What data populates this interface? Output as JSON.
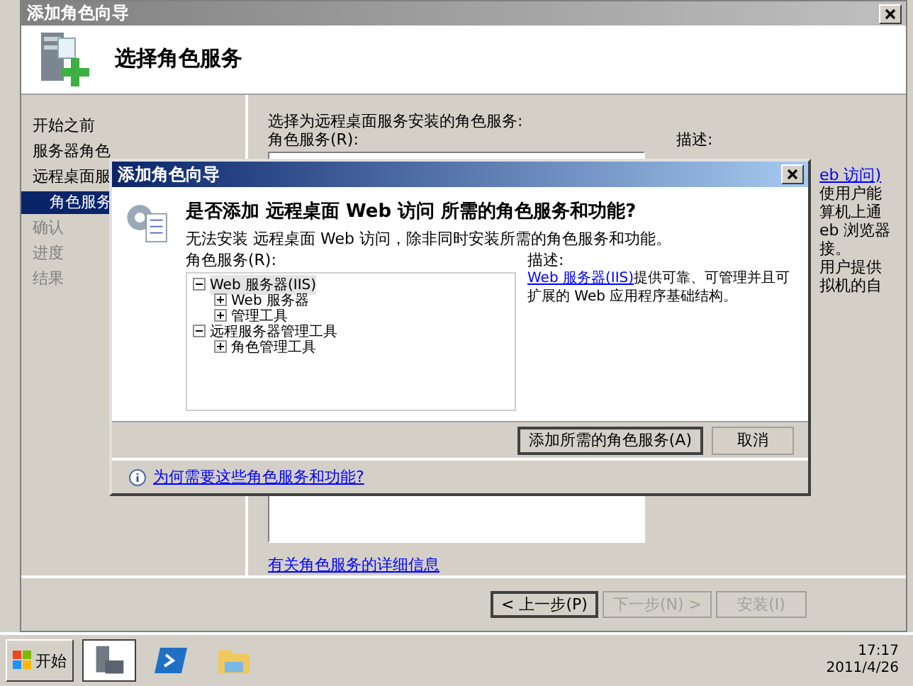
{
  "wizard": {
    "title": "添加角色向导",
    "heading": "选择角色服务",
    "nav": [
      {
        "label": "开始之前",
        "selected": false,
        "disabled": false,
        "indented": false
      },
      {
        "label": "服务器角色",
        "selected": false,
        "disabled": false,
        "indented": false
      },
      {
        "label": "远程桌面服",
        "selected": false,
        "disabled": false,
        "indented": false
      },
      {
        "label": "角色服务",
        "selected": true,
        "disabled": false,
        "indented": true
      },
      {
        "label": "确认",
        "selected": false,
        "disabled": true,
        "indented": false
      },
      {
        "label": "进度",
        "selected": false,
        "disabled": true,
        "indented": false
      },
      {
        "label": "结果",
        "selected": false,
        "disabled": true,
        "indented": false
      }
    ],
    "instruction": "选择为远程桌面服务安装的角色服务:",
    "services_label": "角色服务(R):",
    "description_label": "描述:",
    "description_fragments": [
      {
        "text": "eb 访问)",
        "link": true
      },
      {
        "text": "使用户能",
        "link": false
      },
      {
        "text": "算机上通",
        "link": false
      },
      {
        "text": "eb 浏览器",
        "link": false
      },
      {
        "text": "接。",
        "link": false
      },
      {
        "text": "用户提供",
        "link": false
      },
      {
        "text": "拟机的自",
        "link": false
      }
    ],
    "more_info_link": "有关角色服务的详细信息",
    "buttons": [
      {
        "label": "< 上一步(P)",
        "disabled": false,
        "default": true
      },
      {
        "label": "下一步(N) >",
        "disabled": true,
        "default": false
      },
      {
        "label": "安装(I)",
        "disabled": true,
        "default": false
      }
    ]
  },
  "dialog": {
    "title": "添加角色向导",
    "question": "是否添加 远程桌面 Web 访问 所需的角色服务和功能?",
    "message": "无法安装 远程桌面 Web 访问，除非同时安装所需的角色服务和功能。",
    "services_label": "角色服务(R):",
    "tree": [
      {
        "label": "Web 服务器(IIS)",
        "expanded": true,
        "selected": true,
        "children": [
          {
            "label": "Web 服务器",
            "expanded": false,
            "selected": false
          },
          {
            "label": "管理工具",
            "expanded": false,
            "selected": false
          }
        ]
      },
      {
        "label": "远程服务器管理工具",
        "expanded": true,
        "selected": false,
        "children": [
          {
            "label": "角色管理工具",
            "expanded": false,
            "selected": false
          }
        ]
      }
    ],
    "description_label": "描述:",
    "description_link": "Web 服务器(IIS)",
    "description_text": "提供可靠、可管理并且可扩展的 Web 应用程序基础结构。",
    "buttons": [
      {
        "label": "添加所需的角色服务(A)",
        "default": true
      },
      {
        "label": "取消",
        "default": false
      }
    ],
    "help_link": "为何需要这些角色服务和功能?"
  },
  "taskbar": {
    "start": "开始",
    "apps": [
      {
        "kind": "server",
        "selected": true
      },
      {
        "kind": "shell",
        "selected": false
      },
      {
        "kind": "folder",
        "selected": false
      }
    ],
    "time": "17:17",
    "date": "2011/4/26"
  }
}
